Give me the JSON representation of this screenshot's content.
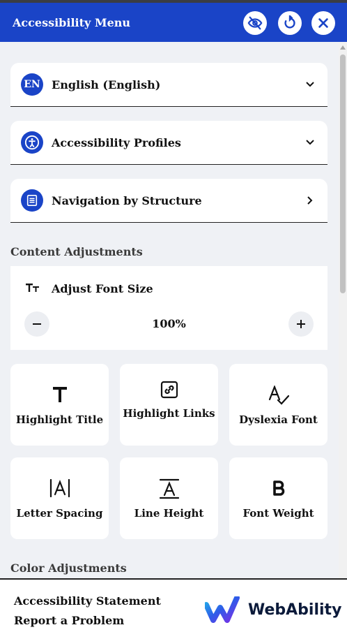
{
  "header": {
    "title": "Accessibility Menu"
  },
  "rows": [
    {
      "label": "English (English)",
      "badge": "EN"
    },
    {
      "label": "Accessibility Profiles"
    },
    {
      "label": "Navigation by Structure"
    }
  ],
  "content_adjustments": {
    "title": "Content Adjustments",
    "font_size": {
      "label": "Adjust Font Size",
      "value": "100%"
    },
    "tiles": [
      {
        "label": "Highlight Title"
      },
      {
        "label": "Highlight Links"
      },
      {
        "label": "Dyslexia Font"
      },
      {
        "label": "Letter Spacing"
      },
      {
        "label": "Line Height"
      },
      {
        "label": "Font Weight"
      }
    ]
  },
  "color_adjustments": {
    "title": "Color Adjustments"
  },
  "footer": {
    "statement": "Accessibility Statement",
    "report": "Report a Problem",
    "logo_text": "WebAbility"
  },
  "colors": {
    "brand_blue": "#1a44c7",
    "background": "#eff1f5"
  },
  "icons": [
    "hide-icon",
    "reset-icon",
    "close-icon",
    "language-badge",
    "accessibility-person-icon",
    "structure-list-icon",
    "chevron-down-icon",
    "chevron-right-icon",
    "font-size-icon",
    "minus-icon",
    "plus-icon",
    "title-t-icon",
    "link-icon",
    "dyslexia-font-icon",
    "letter-spacing-icon",
    "line-height-icon",
    "bold-icon",
    "webability-logo"
  ]
}
